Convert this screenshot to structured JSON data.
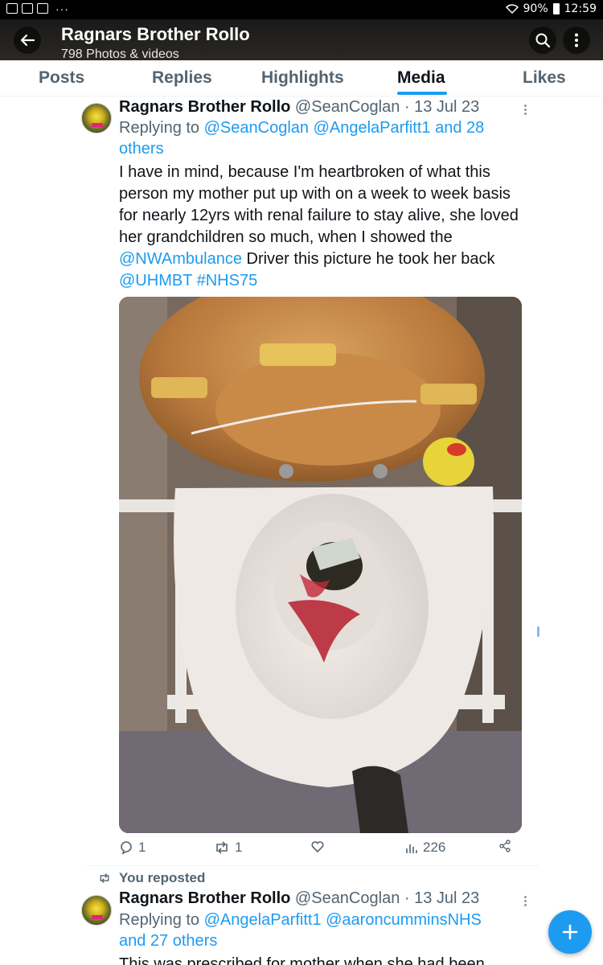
{
  "status_bar": {
    "battery": "90%",
    "time": "12:59",
    "dots": "···"
  },
  "header": {
    "title": "Ragnars Brother Rollo",
    "subtitle": "798 Photos & videos"
  },
  "tabs": [
    {
      "label": "Posts",
      "active": false
    },
    {
      "label": "Replies",
      "active": false
    },
    {
      "label": "Highlights",
      "active": false
    },
    {
      "label": "Media",
      "active": true
    },
    {
      "label": "Likes",
      "active": false
    }
  ],
  "tweet1": {
    "name": "Ragnars Brother Rollo",
    "handle": "@SeanCoglan",
    "sep": "·",
    "date": "13 Jul 23",
    "replying_prefix": "Replying to",
    "replying_mentions": "@SeanCoglan @AngelaParfitt1 and 28 others",
    "text_parts": {
      "p1": "I have in mind, because I'm heartbroken of what this person my mother put up with on a week to week basis for nearly 12yrs with renal failure to stay alive, she loved her grandchildren so much, when I showed the ",
      "mention1": "@NWAmbulance",
      "p2": " Driver this picture he took her back ",
      "mention2": "@UHMBT",
      "hashtag": "#NHS75"
    },
    "replies": "1",
    "reposts": "1",
    "views": "226"
  },
  "reposted_label": "You reposted",
  "tweet2": {
    "name": "Ragnars Brother Rollo",
    "handle": "@SeanCoglan",
    "sep": "·",
    "date": "13 Jul 23",
    "replying_prefix": "Replying to",
    "replying_mentions": "@AngelaParfitt1 @aaroncumminsNHS and 27 others",
    "text_start": "This was prescribed for mother when she had been"
  },
  "colors": {
    "accent": "#1d9bf0",
    "text": "#0f1419",
    "muted": "#536471"
  },
  "icons": [
    "back-arrow-icon",
    "search-icon",
    "more-vertical-icon",
    "reply-icon",
    "repost-icon",
    "like-icon",
    "views-icon",
    "share-icon",
    "plus-icon"
  ]
}
